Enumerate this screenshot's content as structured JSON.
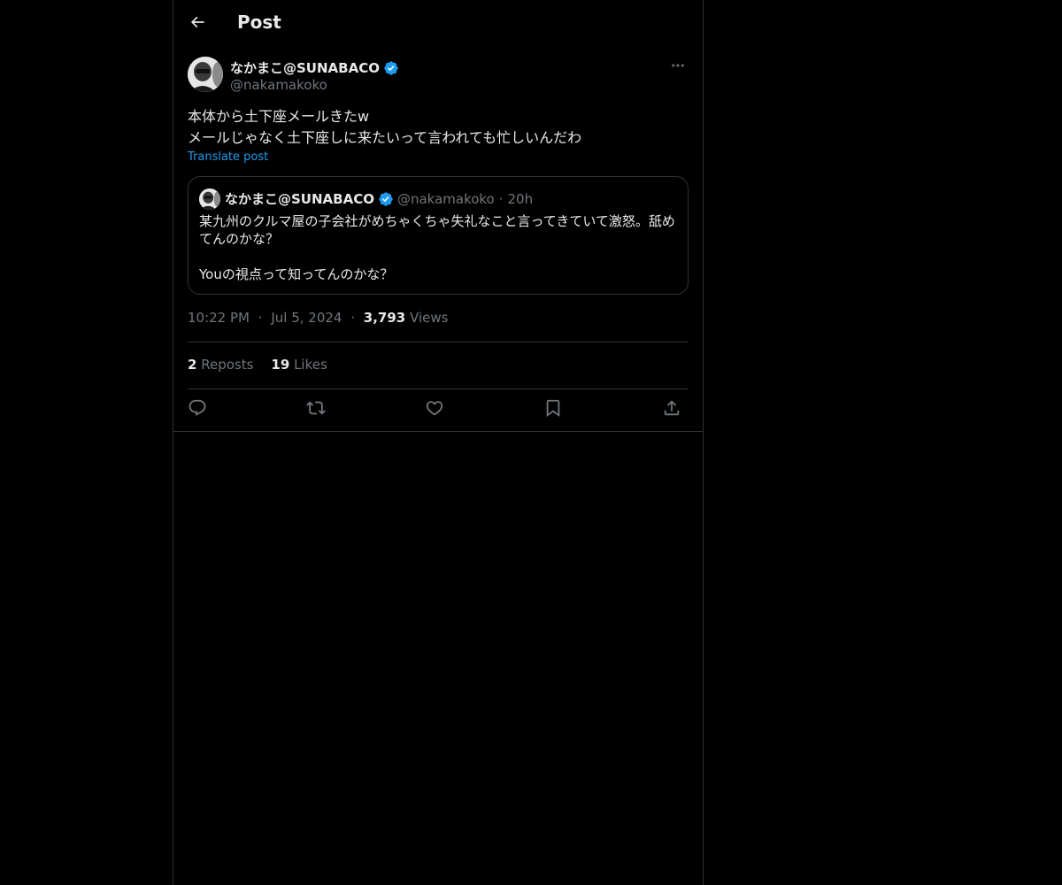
{
  "header": {
    "title": "Post"
  },
  "post": {
    "author_name": "なかまこ@SUNABACO",
    "author_handle": "@nakamakoko",
    "text_lines": [
      "本体から土下座メールきたw",
      "メールじゃなく土下座しに来たいって言われても忙しいんだわ"
    ],
    "translate_label": "Translate post",
    "time": "10:22 PM",
    "date": "Jul 5, 2024",
    "separator": "·",
    "views_count": "3,793",
    "views_label": "Views",
    "reposts_count": "2",
    "reposts_label": "Reposts",
    "likes_count": "19",
    "likes_label": "Likes"
  },
  "quote": {
    "author_name": "なかまこ@SUNABACO",
    "author_handle": "@nakamakoko",
    "separator": "·",
    "time": "20h",
    "lines": [
      "某九州のクルマ屋の子会社がめちゃくちゃ失礼なこと言ってきていて激怒。舐め",
      "てんのかな？",
      "Youの視点って知ってんのかな？"
    ]
  },
  "icons": {
    "back": "back-arrow-icon",
    "verified": "verified-badge-icon",
    "more": "more-icon",
    "reply": "reply-icon",
    "repost": "repost-icon",
    "like": "like-icon",
    "bookmark": "bookmark-icon",
    "share": "share-icon"
  },
  "colors": {
    "background": "#000000",
    "text": "#e7e9ea",
    "secondary_text": "#71767b",
    "accent": "#1d9bf0",
    "border": "#2f3336"
  }
}
